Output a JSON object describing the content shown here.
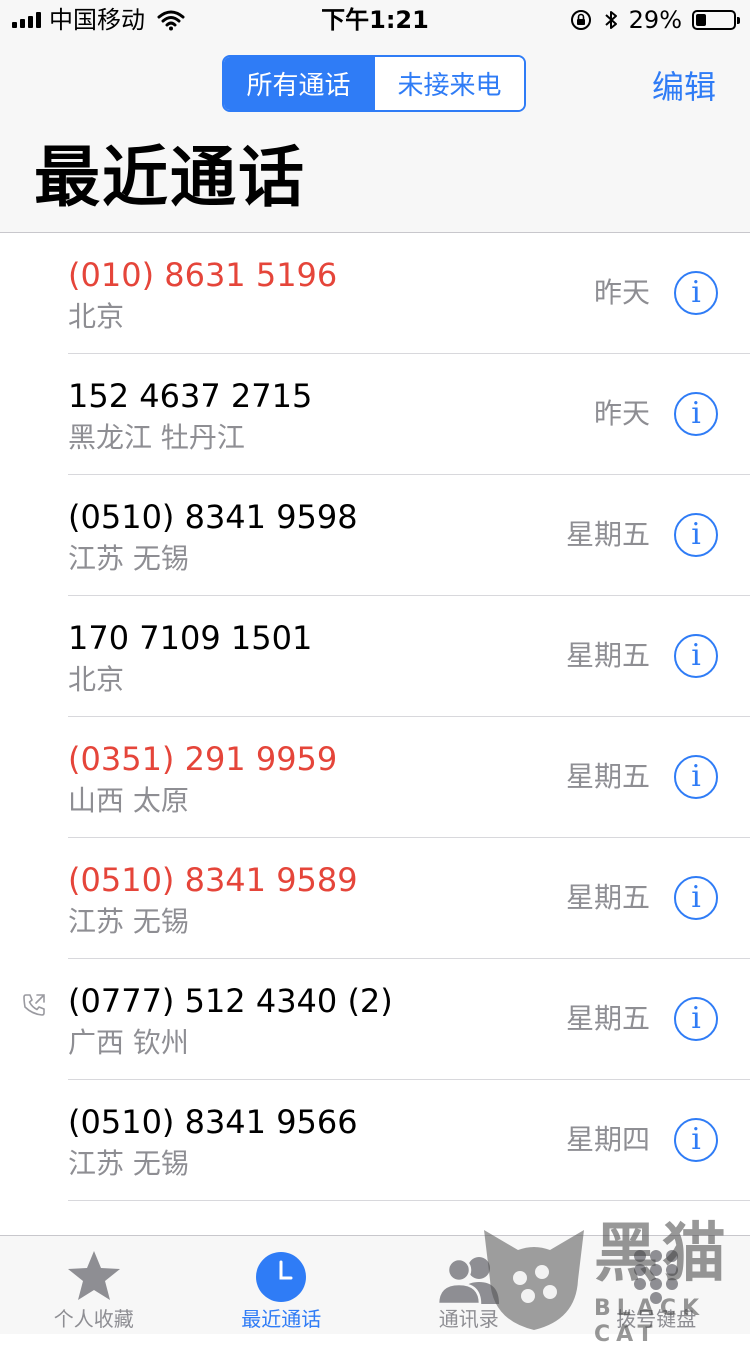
{
  "status_bar": {
    "carrier": "中国移动",
    "time": "下午1:21",
    "battery_pct": "29%",
    "battery_level": 0.29
  },
  "nav": {
    "segments": [
      "所有通话",
      "未接来电"
    ],
    "selected_segment": "所有通话",
    "edit_label": "编辑",
    "title": "最近通话"
  },
  "calls": [
    {
      "number": "(010) 8631 5196",
      "location": "北京",
      "time": "昨天",
      "missed": true
    },
    {
      "number": "152 4637 2715",
      "location": "黑龙江 牡丹江",
      "time": "昨天",
      "missed": false
    },
    {
      "number": "(0510) 8341 9598",
      "location": "江苏 无锡",
      "time": "星期五",
      "missed": false
    },
    {
      "number": "170 7109 1501",
      "location": "北京",
      "time": "星期五",
      "missed": false
    },
    {
      "number": "(0351) 291 9959",
      "location": "山西 太原",
      "time": "星期五",
      "missed": true
    },
    {
      "number": "(0510) 8341 9589",
      "location": "江苏 无锡",
      "time": "星期五",
      "missed": true
    },
    {
      "number": "(0777) 512 4340 (2)",
      "location": "广西 钦州",
      "time": "星期五",
      "missed": false,
      "outgoing": true
    },
    {
      "number": "(0510) 8341 9566",
      "location": "江苏 无锡",
      "time": "星期四",
      "missed": false
    }
  ],
  "tabs": [
    {
      "label": "个人收藏",
      "icon": "star-icon",
      "active": false
    },
    {
      "label": "最近通话",
      "icon": "clock-icon",
      "active": true
    },
    {
      "label": "通讯录",
      "icon": "contacts-icon",
      "active": false
    },
    {
      "label": "拨号键盘",
      "icon": "keypad-icon",
      "active": false
    }
  ],
  "watermark": {
    "text_cn": "黑猫",
    "text_en": "BLACK CAT"
  },
  "colors": {
    "accent": "#2f7cf6",
    "missed": "#e5453a",
    "secondary": "#8e8e93"
  }
}
